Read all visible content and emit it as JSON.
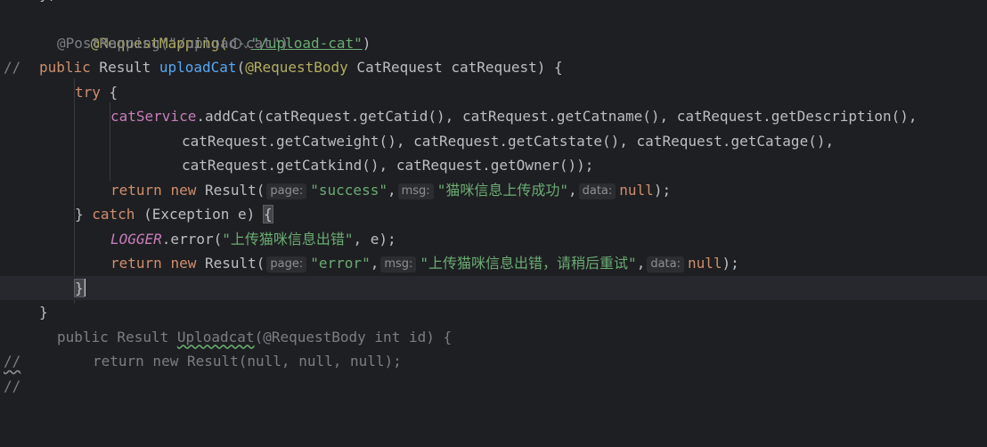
{
  "editor": {
    "top_fragment": "};",
    "lines": [
      {
        "id": "l1",
        "annotation": "@RequestMapping(",
        "url": "\"/upload-cat\"",
        "close": ")"
      },
      {
        "id": "l2",
        "gutter": "//",
        "text": "@PostMapping(\"/upload-cat\")"
      },
      {
        "id": "l3",
        "kw": "public",
        "type": " Result ",
        "fn": "uploadCat",
        "open": "(",
        "annot": "@RequestBody",
        "rest": " CatRequest catRequest) {"
      },
      {
        "id": "l4",
        "kw": "try",
        "rest": " {"
      },
      {
        "id": "l5",
        "field": "catService",
        "rest": ".addCat(catRequest.getCatid(), catRequest.getCatname(), catRequest.getDescription(),"
      },
      {
        "id": "l6",
        "rest": "catRequest.getCatweight(), catRequest.getCatstate(), catRequest.getCatage(),"
      },
      {
        "id": "l7",
        "rest": "catRequest.getCatkind(), catRequest.getOwner());"
      },
      {
        "id": "l8",
        "kw1": "return",
        "kw2": "new",
        "rest": " Result(",
        "hint_page": "page:",
        "str1": "\"success\"",
        "hint_msg": "msg:",
        "str2": "\"猫咪信息上传成功\"",
        "hint_data": "data:",
        "kw3": "null",
        "end": ");"
      },
      {
        "id": "l9",
        "pre": "} ",
        "kw": "catch",
        "rest": " (Exception e) ",
        "brace": "{"
      },
      {
        "id": "l10",
        "field": "LOGGER",
        "rest": ".error(",
        "str": "\"上传猫咪信息出错\"",
        "end": ", e);"
      },
      {
        "id": "l11",
        "kw1": "return",
        "kw2": "new",
        "rest": " Result(",
        "hint_page": "page:",
        "str1": "\"error\"",
        "hint_msg": "msg:",
        "str2": "\"上传猫咪信息出错，请稍后重试\"",
        "hint_data": "data:",
        "kw3": "null",
        "end": ");"
      },
      {
        "id": "l12",
        "text": "}"
      },
      {
        "id": "l13",
        "text": "}"
      },
      {
        "id": "l14",
        "gutter": "//",
        "text_a": "public Result ",
        "text_b": "Uploadcat",
        "text_c": "(@RequestBody int id) {"
      },
      {
        "id": "l15",
        "gutter": "//",
        "text": "return new Result(null, null, null);"
      }
    ]
  }
}
